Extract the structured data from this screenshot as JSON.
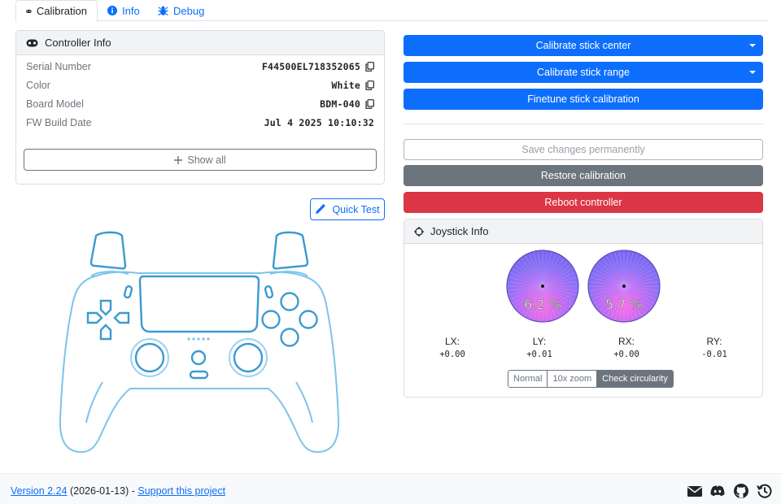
{
  "tabs": [
    {
      "label": "Calibration",
      "icon": "gamepad-icon",
      "active": true
    },
    {
      "label": "Info",
      "icon": "info-icon",
      "active": false
    },
    {
      "label": "Debug",
      "icon": "bug-icon",
      "active": false
    }
  ],
  "controller_info": {
    "title": "Controller Info",
    "rows": [
      {
        "label": "Serial Number",
        "value": "F44500EL718352065",
        "copy": true
      },
      {
        "label": "Color",
        "value": "White",
        "copy": true
      },
      {
        "label": "Board Model",
        "value": "BDM-040",
        "copy": true
      },
      {
        "label": "FW Build Date",
        "value": "Jul 4 2025 10:10:32",
        "copy": false
      }
    ],
    "show_all_label": "Show all"
  },
  "quick_test_label": "Quick Test",
  "actions": {
    "calibrate_center": "Calibrate stick center",
    "calibrate_range": "Calibrate stick range",
    "finetune": "Finetune stick calibration",
    "save": "Save changes permanently",
    "restore": "Restore calibration",
    "reboot": "Reboot controller"
  },
  "joystick_info": {
    "title": "Joystick Info",
    "left_circularity": "6.2 %",
    "right_circularity": "5.7 %",
    "axes": [
      {
        "label": "LX:",
        "value": "+0.00"
      },
      {
        "label": "LY:",
        "value": "+0.01"
      },
      {
        "label": "RX:",
        "value": "+0.00"
      },
      {
        "label": "RY:",
        "value": "-0.01"
      }
    ],
    "view_modes": [
      "Normal",
      "10x zoom",
      "Check circularity"
    ],
    "active_mode": "Check circularity"
  },
  "footer": {
    "version_link": "Version 2.24",
    "date": " (2026-01-13) - ",
    "support_link": "Support this project",
    "icons": [
      "envelope-icon",
      "discord-icon",
      "github-icon",
      "history-icon"
    ]
  },
  "colors": {
    "primary": "#0d6efd",
    "secondary": "#6c757d",
    "danger": "#dc3545",
    "controller_outline": "#7dc4ea",
    "controller_accent": "#3b9bd0"
  }
}
